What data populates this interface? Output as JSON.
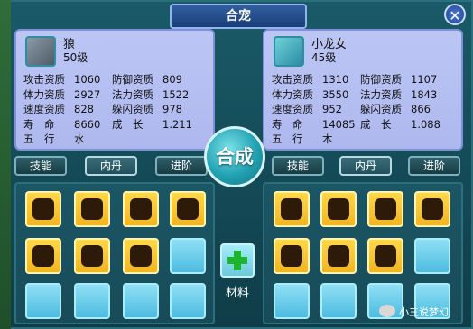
{
  "window": {
    "title": "合宠",
    "close_label": "✕"
  },
  "left_pet": {
    "name": "狼",
    "level": "50级",
    "stats": [
      {
        "label": "攻击资质",
        "value": "1060",
        "label2": "防御资质",
        "value2": "809"
      },
      {
        "label": "体力资质",
        "value": "2927",
        "label2": "法力资质",
        "value2": "1522"
      },
      {
        "label": "速度资质",
        "value": "828",
        "label2": "躲闪资质",
        "value2": "978"
      },
      {
        "label": "寿　命",
        "value": "8660",
        "label2": "成　长",
        "value2": "1.211"
      },
      {
        "label": "五　行",
        "value": "水"
      }
    ]
  },
  "right_pet": {
    "name": "小龙女",
    "level": "45级",
    "stats": [
      {
        "label": "攻击资质",
        "value": "1310",
        "label2": "防御资质",
        "value2": "1107"
      },
      {
        "label": "体力资质",
        "value": "3550",
        "label2": "法力资质",
        "value2": "1843"
      },
      {
        "label": "速度资质",
        "value": "952",
        "label2": "躲闪资质",
        "value2": "866"
      },
      {
        "label": "寿　命",
        "value": "14085",
        "label2": "成　长",
        "value2": "1.088"
      },
      {
        "label": "五　行",
        "value": "木"
      }
    ]
  },
  "tabs": {
    "left": [
      "技能",
      "内丹",
      "进阶"
    ],
    "right": [
      "技能",
      "内丹",
      "进阶"
    ]
  },
  "merge_button": "合成",
  "material": {
    "label": "材料"
  },
  "watermark": "小三说梦幻",
  "colors": {
    "skill_gold": "#f2b520",
    "slot_empty": "#4dbbe0",
    "panel": "#b4bff1"
  }
}
